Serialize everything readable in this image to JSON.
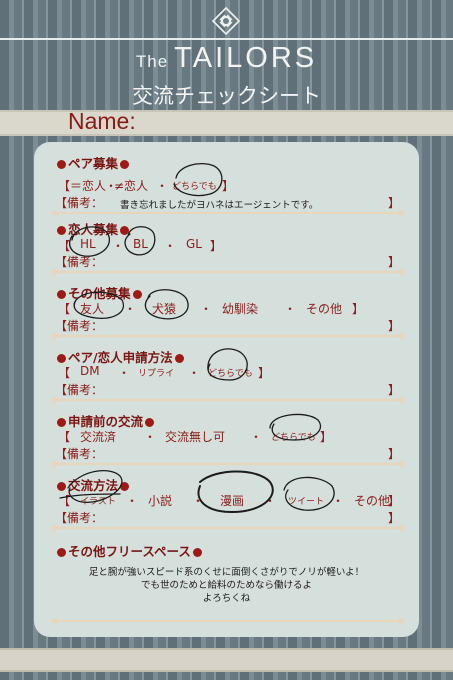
{
  "header": {
    "title_prefix": "The",
    "title_main": "TAILORS",
    "subtitle": "交流チェックシート"
  },
  "name_label": "Name:",
  "sections": {
    "pair": {
      "title": "ペア募集",
      "options": [
        "【＝恋人",
        "・",
        "≠恋人",
        "・",
        "どちらでも",
        "】"
      ],
      "notes_label": "【備考：",
      "bracket_close": "】",
      "note": "書き忘れましたがヨハネはエージェントです。"
    },
    "lover": {
      "title": "恋人募集",
      "options": [
        "【",
        "HL",
        "・",
        "BL",
        "・",
        "GL",
        "】"
      ],
      "notes_label": "【備考：",
      "bracket_close": "】"
    },
    "other": {
      "title": "その他募集",
      "options": [
        "【",
        "友人",
        "・",
        "犬猿",
        "・",
        "幼馴染",
        "・",
        "その他",
        "】"
      ],
      "notes_label": "【備考：",
      "bracket_close": "】"
    },
    "apply": {
      "title": "ペア/恋人申請方法",
      "options": [
        "【",
        "DM",
        "・",
        "リプライ",
        "・",
        "どちらでも",
        "】"
      ],
      "notes_label": "【備考：",
      "bracket_close": "】"
    },
    "pre": {
      "title": "申請前の交流",
      "options": [
        "【",
        "交流済",
        "・",
        "交流無し可",
        "・",
        "どちらでも",
        "】"
      ],
      "notes_label": "【備考：",
      "bracket_close": "】"
    },
    "method": {
      "title": "交流方法",
      "options": [
        "【",
        "イラスト",
        "・",
        "小説",
        "・",
        "漫画",
        "・",
        "ツイート",
        "・",
        "その他",
        "】"
      ],
      "notes_label": "【備考：",
      "bracket_close": "】"
    },
    "free": {
      "title": "その他フリースペース",
      "lines": [
        "足と腕が強いスピード系のくせに面倒くさがりでノリが軽いよ！",
        "でも世のためと給料のためなら働けるよ",
        "よろちくね"
      ]
    }
  },
  "colors": {
    "card": "#d5dfdc",
    "accent_red": "#9e1b14",
    "rule": "#e9d5b9",
    "stripe_dark": "#5f7078",
    "stripe_light": "#7c8d94"
  },
  "selections": [
    "どちらでも",
    "HL",
    "BL",
    "友人",
    "犬猿",
    "どちらでも",
    "どちらでも",
    "イラスト",
    "漫画",
    "ツイート"
  ]
}
